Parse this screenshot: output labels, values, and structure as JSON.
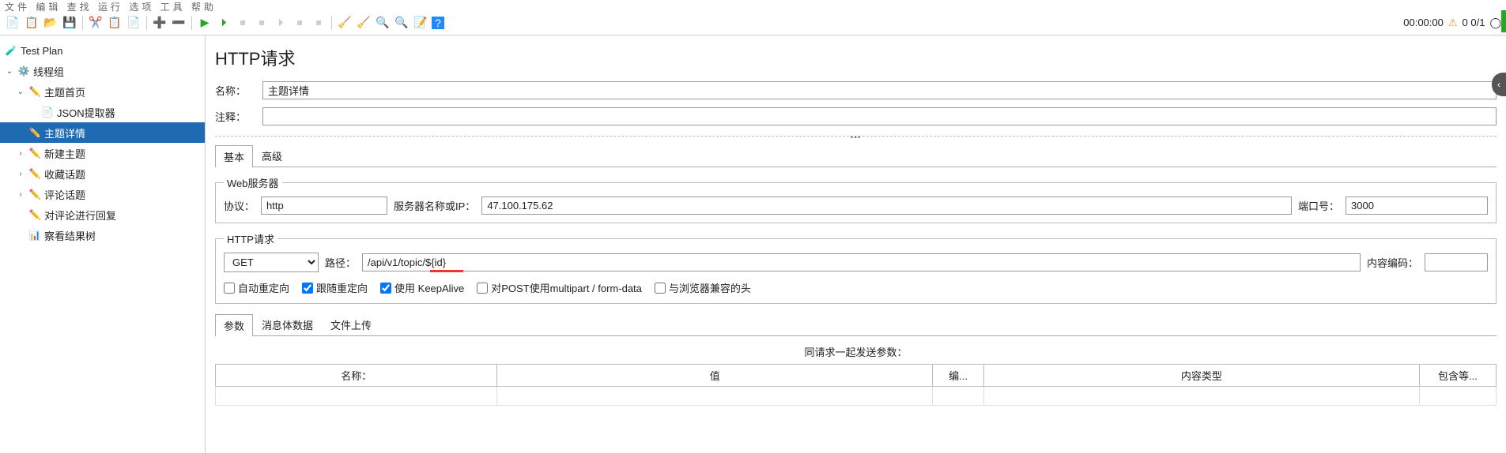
{
  "menubar": "文件  编辑  查找  运行  选项  工具  帮助",
  "status": {
    "time": "00:00:00",
    "warn": "⚠",
    "count": "0  0/1"
  },
  "tree": {
    "root": {
      "label": "Test Plan"
    },
    "thread": {
      "label": "线程组"
    },
    "items": [
      {
        "label": "主题首页",
        "exp": true
      },
      {
        "label": "JSON提取器",
        "child": true
      },
      {
        "label": "主题详情",
        "sel": true
      },
      {
        "label": "新建主题",
        "exp": true
      },
      {
        "label": "收藏话题",
        "exp": true
      },
      {
        "label": "评论话题",
        "exp": true
      },
      {
        "label": "对评论进行回复",
        "child": true
      },
      {
        "label": "察看结果树",
        "child": true
      }
    ]
  },
  "panel": {
    "title": "HTTP请求",
    "name_lbl": "名称：",
    "name_val": "主题详情",
    "comment_lbl": "注释：",
    "comment_val": "",
    "tab_basic": "基本",
    "tab_adv": "高级",
    "fs_web": "Web服务器",
    "proto_lbl": "协议：",
    "proto_val": "http",
    "server_lbl": "服务器名称或IP：",
    "server_val": "47.100.175.62",
    "port_lbl": "端口号：",
    "port_val": "3000",
    "fs_http": "HTTP请求",
    "method": "GET",
    "path_lbl": "路径：",
    "path_val": "/api/v1/topic/${id}",
    "enc_lbl": "内容编码：",
    "enc_val": "",
    "chk_auto": "自动重定向",
    "chk_follow": "跟随重定向",
    "chk_keep": "使用 KeepAlive",
    "chk_multi": "对POST使用multipart / form-data",
    "chk_compat": "与浏览器兼容的头",
    "ptab_param": "参数",
    "ptab_body": "消息体数据",
    "ptab_file": "文件上传",
    "param_head": "同请求一起发送参数：",
    "cols": {
      "name": "名称：",
      "value": "值",
      "enc": "编...",
      "ctype": "内容类型",
      "inc": "包含等..."
    }
  }
}
